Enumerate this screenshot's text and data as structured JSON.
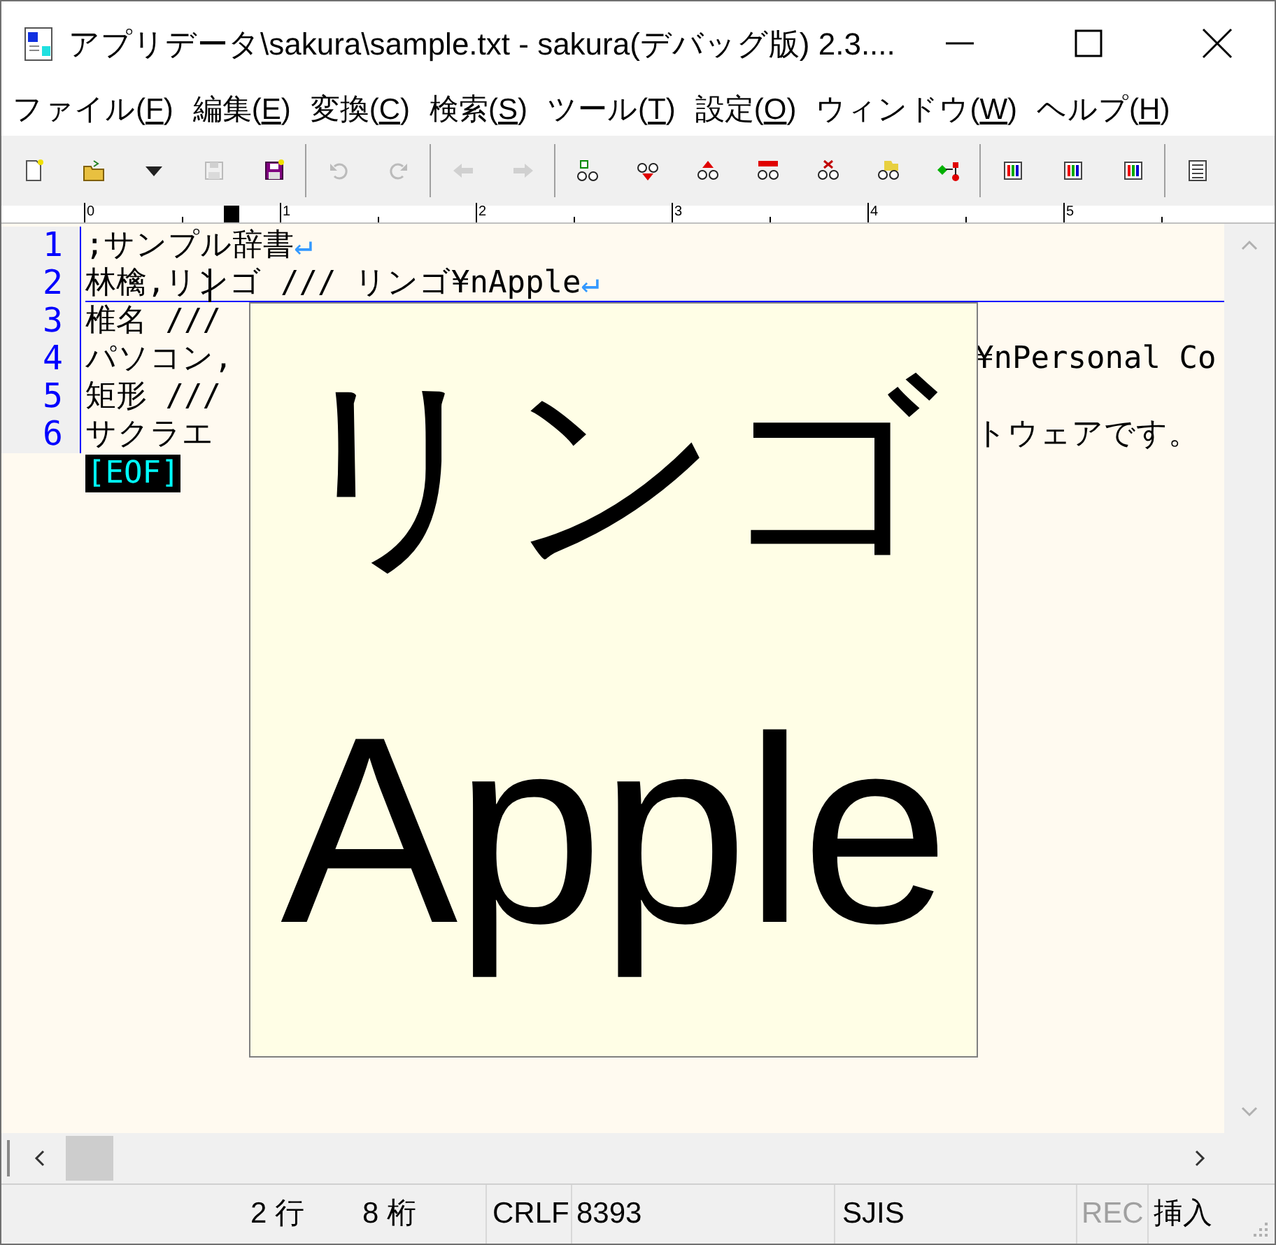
{
  "window": {
    "title": "アプリデータ\\sakura\\sample.txt - sakura(デバッグ版) 2.3...."
  },
  "menu": [
    {
      "before": "ファイル(",
      "key": "F",
      "after": ")"
    },
    {
      "before": "編集(",
      "key": "E",
      "after": ")"
    },
    {
      "before": "変換(",
      "key": "C",
      "after": ")"
    },
    {
      "before": "検索(",
      "key": "S",
      "after": ")"
    },
    {
      "before": "ツール(",
      "key": "T",
      "after": ")"
    },
    {
      "before": "設定(",
      "key": "O",
      "after": ")"
    },
    {
      "before": "ウィンドウ(",
      "key": "W",
      "after": ")"
    },
    {
      "before": "ヘルプ(",
      "key": "H",
      "after": ")"
    }
  ],
  "toolbar": [
    {
      "kind": "new",
      "disabled": false
    },
    {
      "kind": "open",
      "disabled": false
    },
    {
      "kind": "dropdown",
      "disabled": false
    },
    {
      "kind": "save",
      "disabled": true
    },
    {
      "kind": "save-as",
      "disabled": false
    },
    {
      "kind": "separator"
    },
    {
      "kind": "undo",
      "disabled": true
    },
    {
      "kind": "redo",
      "disabled": true
    },
    {
      "kind": "separator"
    },
    {
      "kind": "back",
      "disabled": true
    },
    {
      "kind": "forward",
      "disabled": true
    },
    {
      "kind": "separator"
    },
    {
      "kind": "find",
      "disabled": false
    },
    {
      "kind": "find-next",
      "disabled": false
    },
    {
      "kind": "find-prev",
      "disabled": false
    },
    {
      "kind": "replace",
      "disabled": false
    },
    {
      "kind": "clear",
      "disabled": false
    },
    {
      "kind": "grep",
      "disabled": false
    },
    {
      "kind": "compare",
      "disabled": false
    },
    {
      "kind": "separator"
    },
    {
      "kind": "tool",
      "disabled": false
    },
    {
      "kind": "tool",
      "disabled": false
    },
    {
      "kind": "tool",
      "disabled": false
    },
    {
      "kind": "separator"
    },
    {
      "kind": "list",
      "disabled": false
    }
  ],
  "ruler": [
    "0",
    "1",
    "2",
    "3",
    "4",
    "5"
  ],
  "lines": [
    {
      "number": "1",
      "text": ";サンプル辞書",
      "eol": "↵",
      "cursor": false
    },
    {
      "number": "2",
      "text": "林檎,リンゴ /// リンゴ¥nApple",
      "eol": "↵",
      "cursor": true
    },
    {
      "number": "3",
      "text": "椎名 ///",
      "cursor": false
    },
    {
      "number": "4",
      "text": "パソコン,",
      "right": "¥nPersonal Co",
      "cursor": false
    },
    {
      "number": "5",
      "text": "矩形 ///",
      "cursor": false
    },
    {
      "number": "6",
      "text": "サクラエ",
      "right": "トウェアです。",
      "cursor": false
    }
  ],
  "eof": "[EOF]",
  "popup": {
    "reading": "リンゴ",
    "meaning": "Apple"
  },
  "status_bar": {
    "row": "2 行",
    "column": "8 桁",
    "line_ending": "CRLF",
    "code": "8393",
    "encoding": "SJIS",
    "rec": {
      "label": "REC",
      "disabled": true
    },
    "mode": "挿入"
  }
}
